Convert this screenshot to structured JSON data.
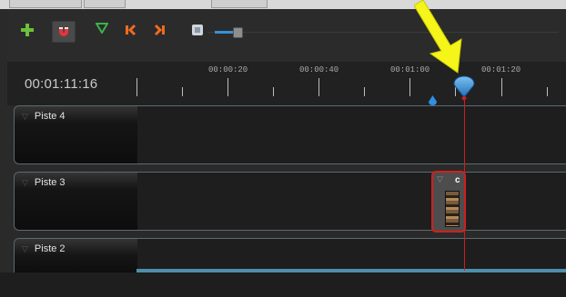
{
  "timeline": {
    "current_time": "00:01:11:16",
    "ruler_labels": [
      "00:00:20",
      "00:00:40",
      "00:01:00",
      "00:01:20"
    ]
  },
  "tracks": [
    {
      "name": "Piste 4"
    },
    {
      "name": "Piste 3"
    },
    {
      "name": "Piste 2"
    }
  ],
  "clip": {
    "label": "c"
  },
  "toolbar": {
    "icons": [
      "add-track-icon",
      "snapping-magnet-icon",
      "add-marker-icon",
      "previous-marker-icon",
      "next-marker-icon",
      "center-on-playhead-icon"
    ],
    "zoom_level": 0.07
  },
  "colors": {
    "playhead": "#cc1f1f",
    "zoom_accent": "#3a8fd6",
    "annotation_arrow": "#f5f51a",
    "add_icon": "#6cc13a",
    "marker_icon": "#3bb34a",
    "nav_icon": "#f06a1e"
  }
}
